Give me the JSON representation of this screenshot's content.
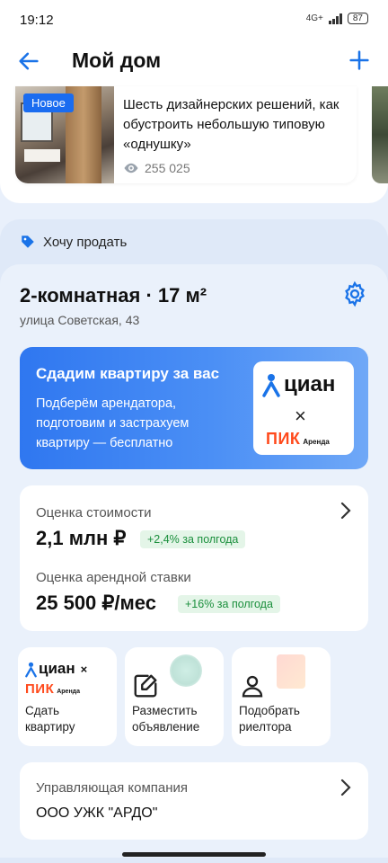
{
  "status_bar": {
    "time": "19:12",
    "network": "4G+",
    "battery": "87"
  },
  "header": {
    "title": "Мой дом",
    "back_icon": "arrow-left-icon",
    "add_icon": "plus-icon"
  },
  "news": {
    "badge": "Новое",
    "title": "Шесть дизайнерских решений, как обустроить небольшую типовую «однушку»",
    "views": "255 025"
  },
  "sell_section": {
    "label": "Хочу продать"
  },
  "flat": {
    "title": "2-комнатная · 17 м²",
    "address": "улица Советская, 43"
  },
  "promo": {
    "title": "Сдадим квартиру за вас",
    "description": "Подберём арендатора, подготовим и застрахуем квартиру — бесплатно",
    "logo_cian": "циан",
    "logo_times": "×",
    "logo_pik": "ПИК",
    "logo_arenda": "Аренда"
  },
  "valuation": {
    "price_label": "Оценка стоимости",
    "price_value": "2,1 млн ₽",
    "price_change": "+2,4% за полгода",
    "rent_label": "Оценка арендной ставки",
    "rent_value": "25 500 ₽/мес",
    "rent_change": "+16% за полгода"
  },
  "tiles": [
    {
      "label": "Сдать квартиру",
      "logo_cian": "циан",
      "logo_times": "×",
      "logo_pik": "ПИК",
      "logo_arenda": "Аренда"
    },
    {
      "label": "Разместить объявление",
      "icon": "edit-listing-icon"
    },
    {
      "label": "Подобрать риелтора",
      "icon": "person-icon"
    }
  ],
  "management": {
    "label": "Управляющая компания",
    "value": "ООО УЖК \"АРДО\""
  },
  "colors": {
    "accent": "#1a73e8",
    "positive": "#1a8f3c",
    "pik": "#ff4a1c"
  }
}
